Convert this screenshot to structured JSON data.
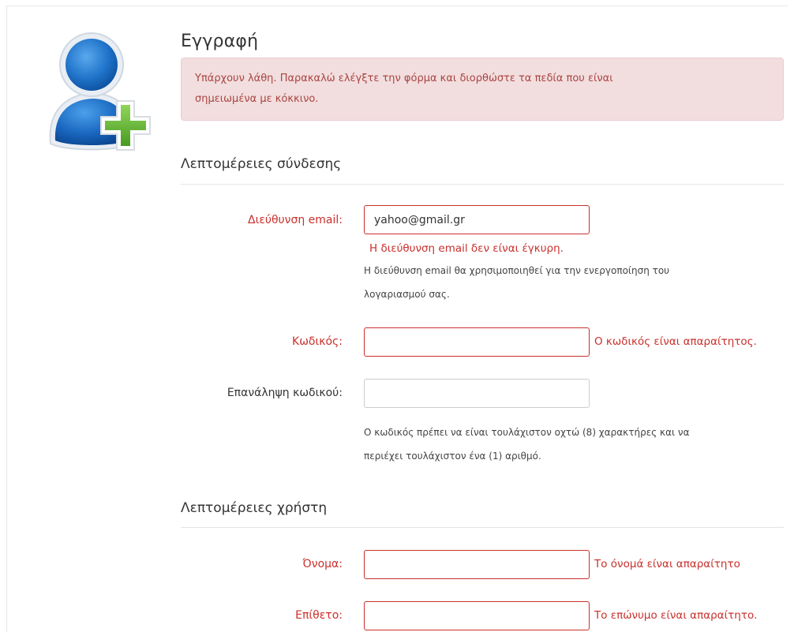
{
  "page": {
    "title": "Εγγραφή"
  },
  "alert": {
    "line1": "Υπάρχουν λάθη. Παρακαλώ ελέγξτε την φόρμα και διορθώστε τα πεδία που είναι",
    "line2": "σημειωμένα με κόκκινο."
  },
  "login_section": {
    "title": "Λεπτομέρειες σύνδεσης",
    "email": {
      "label": "Διεύθυνση email:",
      "value": "yahoo@gmail.gr",
      "error": "Η διεύθυνση email δεν είναι έγκυρη.",
      "help_line1": "Η διεύθυνση email θα χρησιμοποιηθεί για την ενεργοποίηση του",
      "help_line2": "λογαριασμού σας."
    },
    "password": {
      "label": "Κωδικός:",
      "value": "",
      "error": "Ο κωδικός είναι απαραίτητος."
    },
    "password_repeat": {
      "label": "Επανάληψη κωδικού:",
      "value": "",
      "help_line1": "Ο κωδικός πρέπει να είναι τουλάχιστον οχτώ (8) χαρακτήρες και να",
      "help_line2": "περιέχει τουλάχιστον ένα (1) αριθμό."
    }
  },
  "user_section": {
    "title": "Λεπτομέρειες χρήστη",
    "first_name": {
      "label": "Όνομα:",
      "value": "",
      "error": "Το όνομά είναι απαραίτητο"
    },
    "last_name": {
      "label": "Επίθετο:",
      "value": "",
      "error": "Το επώνυμο είναι απαραίτητο."
    }
  },
  "colors": {
    "error": "#c9302c",
    "alert_bg": "#f2dede",
    "avatar_blue": "#1565c0",
    "plus_green": "#6abf3a"
  },
  "icons": {
    "avatar": "user-add-icon"
  }
}
